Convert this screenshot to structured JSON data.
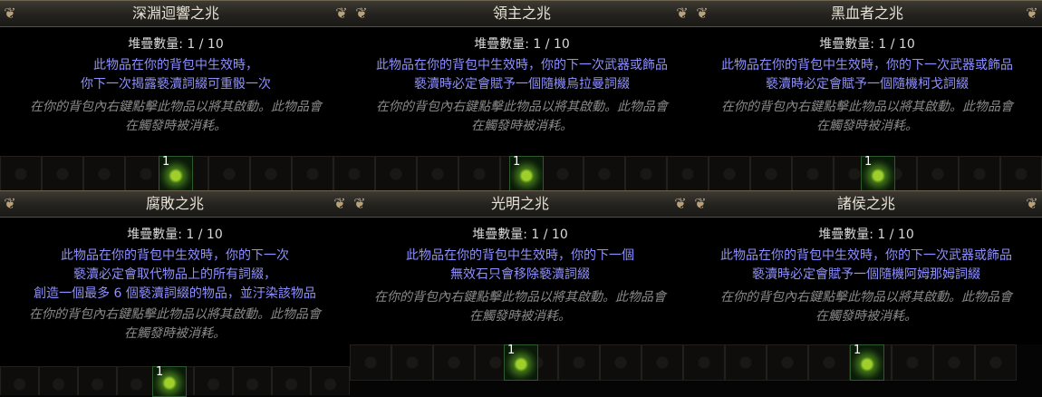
{
  "cards": [
    {
      "title": "深淵迴響之兆",
      "stack": "堆疊數量: 1 / 10",
      "desc": [
        "此物品在你的背包中生效時，",
        "你下一次揭露褻瀆詞綴可重骰一次"
      ],
      "flavor": [
        "在你的背包內右鍵點擊此物品以將其啟動。此物品會",
        "在觸發時被消耗。"
      ],
      "quantity": "1",
      "icon": "omen-icon"
    },
    {
      "title": "領主之兆",
      "stack": "堆疊數量: 1 / 10",
      "desc": [
        "此物品在你的背包中生效時，你的下一次武器或飾品",
        "褻瀆時必定會賦予一個隨機烏拉曼詞綴"
      ],
      "flavor": [
        "在你的背包內右鍵點擊此物品以將其啟動。此物品會",
        "在觸發時被消耗。"
      ],
      "quantity": "1",
      "icon": "omen-icon"
    },
    {
      "title": "黑血者之兆",
      "stack": "堆疊數量: 1 / 10",
      "desc": [
        "此物品在你的背包中生效時，你的下一次武器或飾品",
        "褻瀆時必定會賦予一個隨機柯戈詞綴"
      ],
      "flavor": [
        "在你的背包內右鍵點擊此物品以將其啟動。此物品會",
        "在觸發時被消耗。"
      ],
      "quantity": "1",
      "icon": "omen-icon"
    },
    {
      "title": "腐敗之兆",
      "stack": "堆疊數量: 1 / 10",
      "desc": [
        "此物品在你的背包中生效時，你的下一次",
        "褻瀆必定會取代物品上的所有詞綴，",
        "創造一個最多 6 個褻瀆詞綴的物品，並汙染該物品"
      ],
      "flavor": [
        "在你的背包內右鍵點擊此物品以將其啟動。此物品會",
        "在觸發時被消耗。"
      ],
      "quantity": "1",
      "icon": "omen-icon"
    },
    {
      "title": "光明之兆",
      "stack": "堆疊數量: 1 / 10",
      "desc": [
        "此物品在你的背包中生效時，你的下一個",
        "無效石只會移除褻瀆詞綴"
      ],
      "flavor": [
        "在你的背包內右鍵點擊此物品以將其啟動。此物品會",
        "在觸發時被消耗。"
      ],
      "quantity": "1",
      "icon": "omen-icon"
    },
    {
      "title": "諸侯之兆",
      "stack": "堆疊數量: 1 / 10",
      "desc": [
        "此物品在你的背包中生效時，你的下一次武器或飾品",
        "褻瀆時必定會賦予一個隨機阿姆那姆詞綴"
      ],
      "flavor": [
        "在你的背包內右鍵點擊此物品以將其啟動。此物品會",
        "在觸發時被消耗。"
      ],
      "quantity": "1",
      "icon": "omen-icon"
    }
  ]
}
